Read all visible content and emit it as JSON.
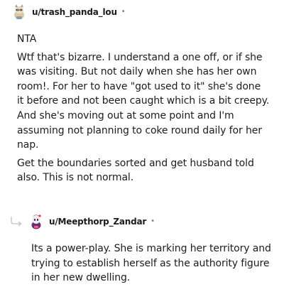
{
  "comments": [
    {
      "username": "u/trash_panda_lou",
      "separator": "•",
      "avatar_icon": "snoo-avatar-icon",
      "paragraphs": [
        "NTA",
        "Wtf that's bizarre. I understand a one off, or if she was visiting. But not daily when she has her own room!. For her to have \"got used to it\" she's done it before and not been caught which is a bit creepy. And she's moving out at some point and I'm assuming not planning to coke round daily for her nap.",
        "Get the boundaries sorted and get husband told also. This is not normal."
      ]
    },
    {
      "username": "u/Meepthorp_Zandar",
      "separator": "•",
      "avatar_icon": "snoo-avatar-icon",
      "reply_icon": "reply-arrow-icon",
      "paragraphs": [
        "Its a power-play. She is marking her territory and trying to establish herself as the authority figure in her new dwelling."
      ]
    }
  ],
  "colors": {
    "text": "#1c1c1c",
    "meta": "#787c7e",
    "connector": "#c8cbcd"
  }
}
